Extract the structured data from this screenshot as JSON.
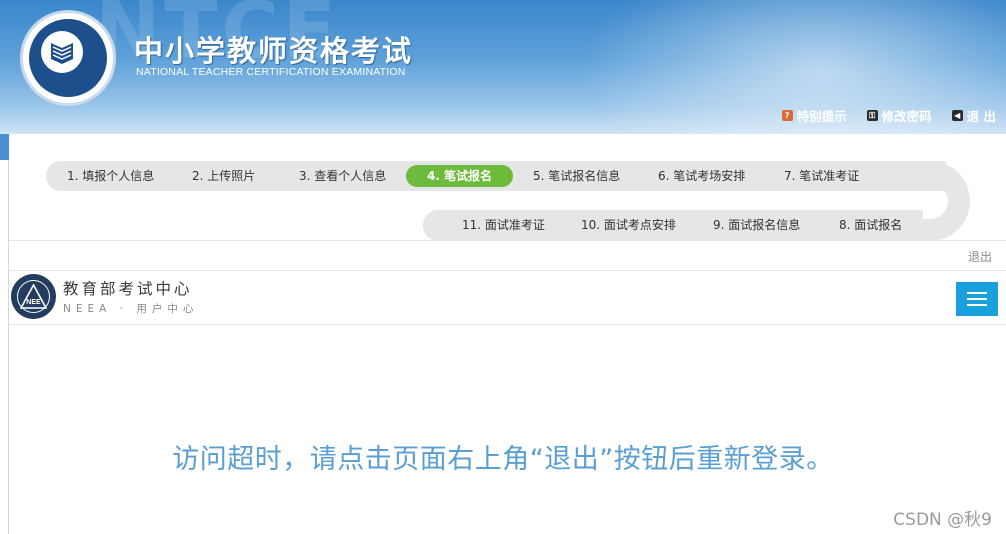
{
  "header": {
    "title": "中小学教师资格考试",
    "subtitle": "NATIONAL TEACHER CERTIFICATION EXAMINATION",
    "watermark": "NTCE",
    "links": [
      {
        "label": "特别提示",
        "icon": "warning-icon",
        "color": "#e06a35"
      },
      {
        "label": "修改密码",
        "icon": "key-icon",
        "color": "#2a2a2a"
      },
      {
        "label": "退 出",
        "icon": "exit-icon",
        "color": "#2a2a2a"
      }
    ]
  },
  "steps": {
    "row1": [
      {
        "label": "1. 填报个人信息"
      },
      {
        "label": "2. 上传照片"
      },
      {
        "label": "3. 查看个人信息"
      },
      {
        "label": "4. 笔试报名",
        "active": true
      },
      {
        "label": "5. 笔试报名信息"
      },
      {
        "label": "6. 笔试考场安排"
      },
      {
        "label": "7. 笔试准考证"
      }
    ],
    "row2": [
      {
        "label": "11. 面试准考证"
      },
      {
        "label": "10. 面试考点安排"
      },
      {
        "label": "9. 面试报名信息"
      },
      {
        "label": "8. 面试报名"
      }
    ],
    "active_color": "#6dbb3c"
  },
  "frame": {
    "logout": "退出",
    "org_name": "教育部考试中心",
    "org_sub": "NEEA · 用户中心",
    "menu_icon": "hamburger-menu-icon",
    "menu_color": "#1aa0dd"
  },
  "message": "访问超时，请点击页面右上角“退出”按钮后重新登录。",
  "watermark_footer": "CSDN @秋9"
}
